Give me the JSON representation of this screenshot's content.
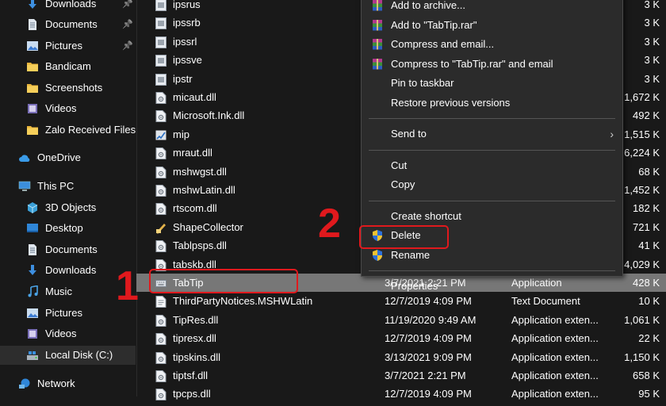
{
  "nav": [
    {
      "label": "Downloads",
      "icon": "download-icon",
      "pinned": true
    },
    {
      "label": "Documents",
      "icon": "documents-icon",
      "pinned": true
    },
    {
      "label": "Pictures",
      "icon": "pictures-icon",
      "pinned": true
    },
    {
      "label": "Bandicam",
      "icon": "folder-icon",
      "pinned": false
    },
    {
      "label": "Screenshots",
      "icon": "folder-icon",
      "pinned": false
    },
    {
      "label": "Videos",
      "icon": "videos-icon",
      "pinned": false
    },
    {
      "label": "Zalo Received Files",
      "icon": "folder-icon",
      "pinned": false
    },
    {
      "label": "OneDrive",
      "icon": "onedrive-icon",
      "pinned": false
    },
    {
      "label": "This PC",
      "icon": "this-pc-icon",
      "pinned": false
    },
    {
      "label": "3D Objects",
      "icon": "3d-objects-icon",
      "pinned": false
    },
    {
      "label": "Desktop",
      "icon": "desktop-icon",
      "pinned": false
    },
    {
      "label": "Documents",
      "icon": "documents-icon",
      "pinned": false
    },
    {
      "label": "Downloads",
      "icon": "download-icon",
      "pinned": false
    },
    {
      "label": "Music",
      "icon": "music-icon",
      "pinned": false
    },
    {
      "label": "Pictures",
      "icon": "pictures-icon",
      "pinned": false
    },
    {
      "label": "Videos",
      "icon": "videos-icon",
      "pinned": false
    },
    {
      "label": "Local Disk (C:)",
      "icon": "local-disk-icon",
      "pinned": false,
      "selected": true
    },
    {
      "label": "Network",
      "icon": "network-icon",
      "pinned": false
    }
  ],
  "pin_glyph": "📌",
  "files": [
    {
      "name": "ipsrus",
      "date": "",
      "type": "",
      "size": "3 K",
      "icon": "application-icon"
    },
    {
      "name": "ipssrb",
      "date": "",
      "type": "",
      "size": "3 K",
      "icon": "application-icon"
    },
    {
      "name": "ipssrl",
      "date": "",
      "type": "",
      "size": "3 K",
      "icon": "application-icon"
    },
    {
      "name": "ipssve",
      "date": "",
      "type": "",
      "size": "3 K",
      "icon": "application-icon"
    },
    {
      "name": "ipstr",
      "date": "",
      "type": "",
      "size": "3 K",
      "icon": "application-icon"
    },
    {
      "name": "micaut.dll",
      "date": "",
      "type": "",
      "size": "1,672 K",
      "icon": "dll-icon"
    },
    {
      "name": "Microsoft.Ink.dll",
      "date": "",
      "type": "",
      "size": "492 K",
      "icon": "dll-icon"
    },
    {
      "name": "mip",
      "date": "",
      "type": "",
      "size": "1,515 K",
      "icon": "mip-icon"
    },
    {
      "name": "mraut.dll",
      "date": "",
      "type": "",
      "size": "6,224 K",
      "icon": "dll-icon"
    },
    {
      "name": "mshwgst.dll",
      "date": "",
      "type": "",
      "size": "68 K",
      "icon": "dll-icon"
    },
    {
      "name": "mshwLatin.dll",
      "date": "",
      "type": "",
      "size": "1,452 K",
      "icon": "dll-icon"
    },
    {
      "name": "rtscom.dll",
      "date": "",
      "type": "",
      "size": "182 K",
      "icon": "dll-icon"
    },
    {
      "name": "ShapeCollector",
      "date": "",
      "type": "",
      "size": "721 K",
      "icon": "shape-collector-icon"
    },
    {
      "name": "Tablpsps.dll",
      "date": "",
      "type": "",
      "size": "41 K",
      "icon": "dll-icon"
    },
    {
      "name": "tabskb.dll",
      "date": "",
      "type": "",
      "size": "4,029 K",
      "icon": "dll-icon"
    },
    {
      "name": "TabTip",
      "date": "3/7/2021 2:21 PM",
      "type": "Application",
      "size": "428 K",
      "icon": "keyboard-icon",
      "selected": true
    },
    {
      "name": "ThirdPartyNotices.MSHWLatin",
      "date": "12/7/2019 4:09 PM",
      "type": "Text Document",
      "size": "10 K",
      "icon": "text-document-icon"
    },
    {
      "name": "TipRes.dll",
      "date": "11/19/2020 9:49 AM",
      "type": "Application exten...",
      "size": "1,061 K",
      "icon": "dll-icon"
    },
    {
      "name": "tipresx.dll",
      "date": "12/7/2019 4:09 PM",
      "type": "Application exten...",
      "size": "22 K",
      "icon": "dll-icon"
    },
    {
      "name": "tipskins.dll",
      "date": "3/13/2021 9:09 PM",
      "type": "Application exten...",
      "size": "1,150 K",
      "icon": "dll-icon"
    },
    {
      "name": "tiptsf.dll",
      "date": "3/7/2021 2:21 PM",
      "type": "Application exten...",
      "size": "658 K",
      "icon": "dll-icon"
    },
    {
      "name": "tpcps.dll",
      "date": "12/7/2019 4:09 PM",
      "type": "Application exten...",
      "size": "95 K",
      "icon": "dll-icon"
    }
  ],
  "context_menu": [
    {
      "label": "Add to archive...",
      "icon": "winrar-icon"
    },
    {
      "label": "Add to \"TabTip.rar\"",
      "icon": "winrar-icon"
    },
    {
      "label": "Compress and email...",
      "icon": "winrar-icon"
    },
    {
      "label": "Compress to \"TabTip.rar\" and email",
      "icon": "winrar-icon"
    },
    {
      "label": "Pin to taskbar",
      "icon": ""
    },
    {
      "label": "Restore previous versions",
      "icon": ""
    },
    {
      "separator": true
    },
    {
      "label": "Send to",
      "icon": "",
      "submenu": true
    },
    {
      "separator": true
    },
    {
      "label": "Cut",
      "icon": ""
    },
    {
      "label": "Copy",
      "icon": ""
    },
    {
      "separator": true
    },
    {
      "label": "Create shortcut",
      "icon": ""
    },
    {
      "label": "Delete",
      "icon": "uac-shield-icon"
    },
    {
      "label": "Rename",
      "icon": "uac-shield-icon",
      "highlighted": true
    },
    {
      "separator": true
    },
    {
      "label": "Properties",
      "icon": ""
    }
  ],
  "submenu_arrow": "›",
  "annotations": {
    "step1": "1",
    "step2": "2"
  },
  "colors": {
    "background": "#191919",
    "selection": "#777777",
    "menu": "#2b2b2b",
    "annotation_red": "#e0191d",
    "folder_yellow": "#f3c94a"
  }
}
